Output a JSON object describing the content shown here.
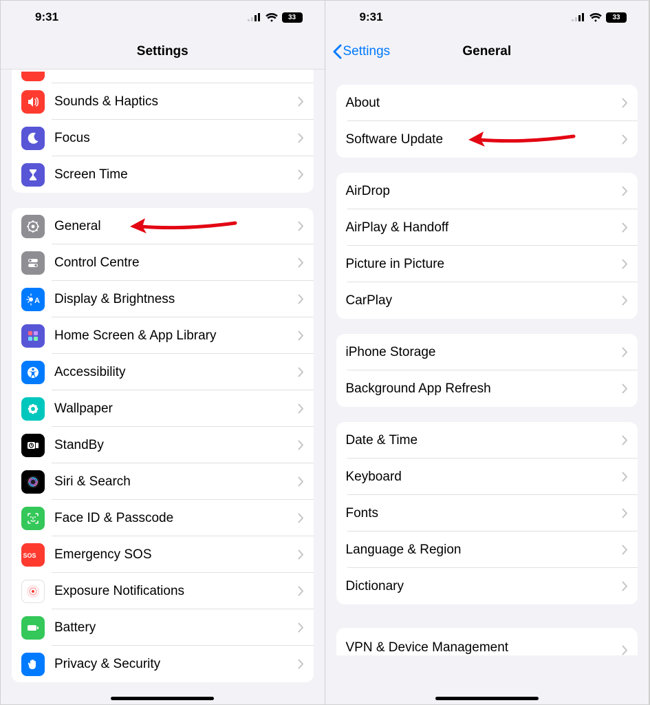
{
  "statusbar": {
    "time": "9:31",
    "battery": "33"
  },
  "left": {
    "title": "Settings",
    "groups": [
      {
        "cutTop": true,
        "rows": [
          {
            "partial": true
          },
          {
            "icon": "speaker",
            "color": "#ff3b30",
            "label": "Sounds & Haptics"
          },
          {
            "icon": "moon",
            "color": "#5856d6",
            "label": "Focus"
          },
          {
            "icon": "hourglass",
            "color": "#5856d6",
            "label": "Screen Time"
          }
        ]
      },
      {
        "rows": [
          {
            "icon": "gear",
            "color": "#8e8e93",
            "label": "General",
            "arrow": true
          },
          {
            "icon": "switches",
            "color": "#8e8e93",
            "label": "Control Centre"
          },
          {
            "icon": "sun-text",
            "color": "#007aff",
            "label": "Display & Brightness"
          },
          {
            "icon": "grid",
            "color": "#5856d6",
            "label": "Home Screen & App Library"
          },
          {
            "icon": "accessibility",
            "color": "#007aff",
            "label": "Accessibility"
          },
          {
            "icon": "flower",
            "color": "#00c7be",
            "label": "Wallpaper"
          },
          {
            "icon": "standby",
            "color": "#000000",
            "label": "StandBy"
          },
          {
            "icon": "siri",
            "color": "#000000",
            "label": "Siri & Search"
          },
          {
            "icon": "faceid",
            "color": "#34c759",
            "label": "Face ID & Passcode"
          },
          {
            "icon": "sos",
            "color": "#ff3b30",
            "label": "Emergency SOS"
          },
          {
            "icon": "exposure",
            "color": "#ffffff",
            "label": "Exposure Notifications"
          },
          {
            "icon": "battery",
            "color": "#34c759",
            "label": "Battery"
          },
          {
            "icon": "hand",
            "color": "#007aff",
            "label": "Privacy & Security"
          }
        ]
      }
    ]
  },
  "right": {
    "back": "Settings",
    "title": "General",
    "groups": [
      {
        "rows": [
          {
            "label": "About"
          },
          {
            "label": "Software Update",
            "arrow": true
          }
        ]
      },
      {
        "rows": [
          {
            "label": "AirDrop"
          },
          {
            "label": "AirPlay & Handoff"
          },
          {
            "label": "Picture in Picture"
          },
          {
            "label": "CarPlay"
          }
        ]
      },
      {
        "rows": [
          {
            "label": "iPhone Storage"
          },
          {
            "label": "Background App Refresh"
          }
        ]
      },
      {
        "rows": [
          {
            "label": "Date & Time"
          },
          {
            "label": "Keyboard"
          },
          {
            "label": "Fonts"
          },
          {
            "label": "Language & Region"
          },
          {
            "label": "Dictionary"
          }
        ]
      },
      {
        "cutBottom": true,
        "rows": [
          {
            "label": "VPN & Device Management"
          }
        ]
      }
    ]
  }
}
